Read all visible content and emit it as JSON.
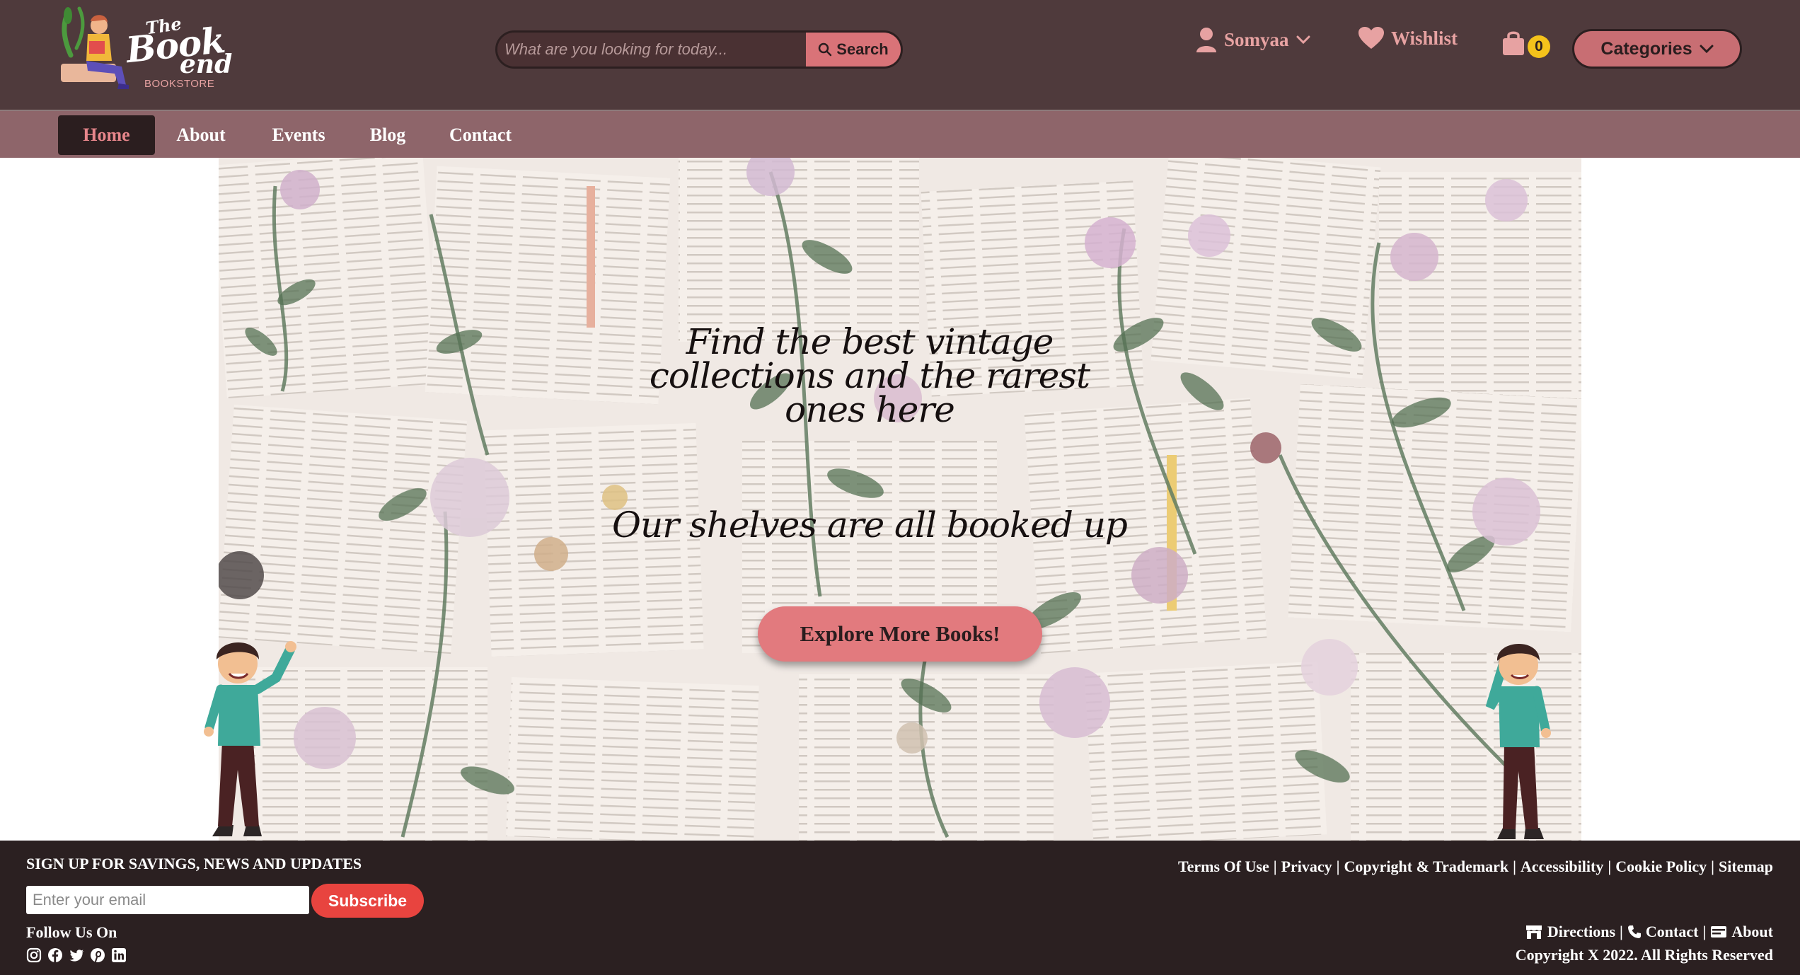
{
  "brand": {
    "line1": "The",
    "line2": "Book",
    "line3": "end",
    "subtitle": "BOOKSTORE"
  },
  "search": {
    "placeholder": "What are you looking for today...",
    "button_label": "Search",
    "icon": "search-icon"
  },
  "header": {
    "user_name": "Somyaa",
    "wishlist_label": "Wishlist",
    "cart_count": "0",
    "categories_label": "Categories"
  },
  "nav": {
    "items": [
      {
        "label": "Home",
        "active": true
      },
      {
        "label": "About",
        "active": false
      },
      {
        "label": "Events",
        "active": false
      },
      {
        "label": "Blog",
        "active": false
      },
      {
        "label": "Contact",
        "active": false
      }
    ]
  },
  "hero": {
    "title": "Find the best vintage collections and the rarest ones here",
    "subtitle": "Our shelves are all booked up",
    "cta_label": "Explore More Books!"
  },
  "footer": {
    "signup_heading": "SIGN UP FOR SAVINGS, NEWS AND UPDATES",
    "email_placeholder": "Enter your email",
    "subscribe_label": "Subscribe",
    "follow_label": "Follow Us On",
    "social_icons": [
      "instagram-icon",
      "facebook-icon",
      "twitter-icon",
      "pinterest-icon",
      "linkedin-icon"
    ],
    "links": [
      "Terms Of Use",
      "Privacy",
      "Copyright & Trademark",
      "Accessibility",
      "Cookie Policy",
      "Sitemap"
    ],
    "bottom_links": [
      "Directions",
      "Contact",
      "About"
    ],
    "copyright": "Copyright X 2022. All Rights Reserved"
  },
  "colors": {
    "header_bg": "#4f3a3c",
    "nav_bg": "#8e656a",
    "accent_pink": "#e7a2a2",
    "cta": "#e27a7e",
    "footer_bg": "#2b2021",
    "subscribe": "#e8443f",
    "cart_badge": "#f4c21b"
  }
}
